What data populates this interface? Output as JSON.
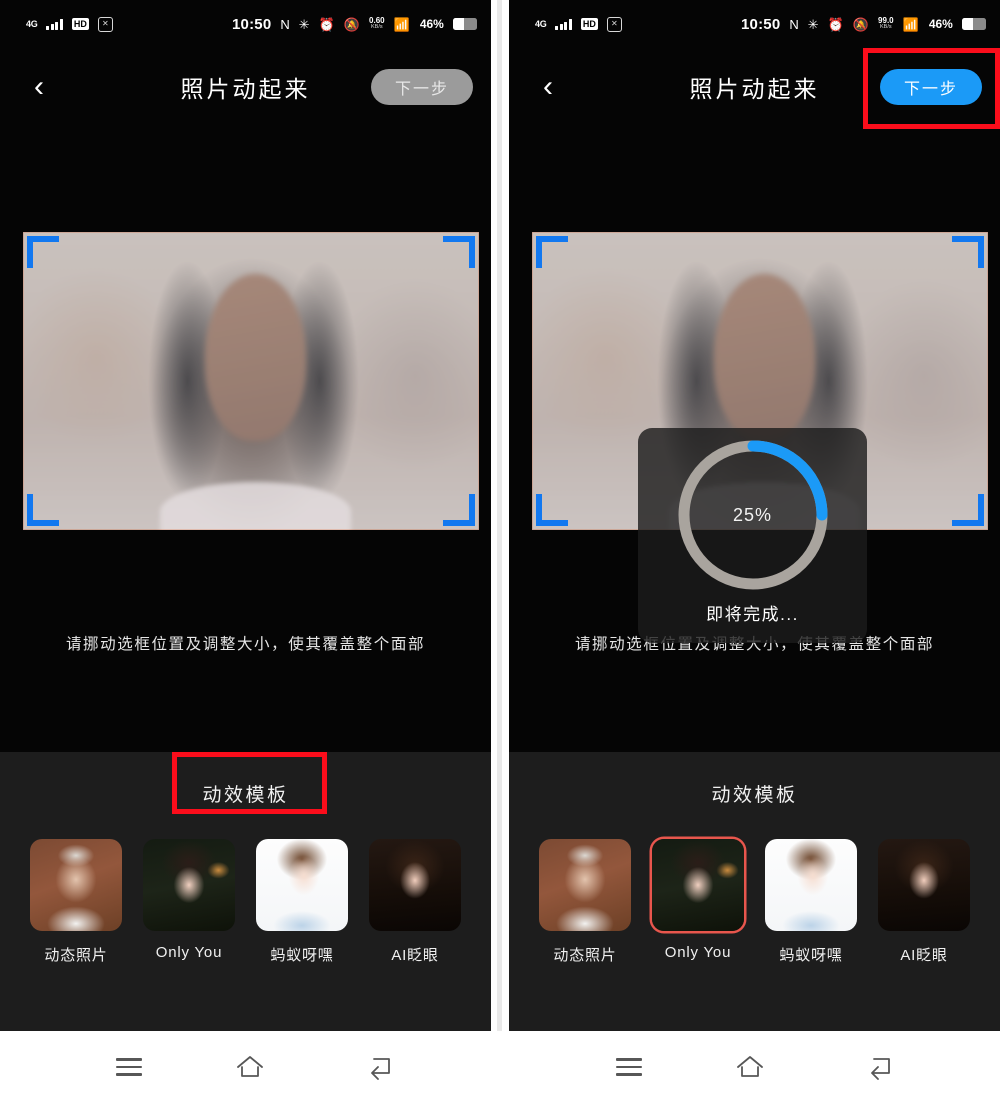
{
  "app": {
    "title": "照片动起来",
    "back_icon": "chevron-left-icon",
    "next_button": "下一步"
  },
  "status_bar": {
    "network": "4G",
    "hd_badge": "HD",
    "boxed_icon": "no-sim-icon",
    "time": "10:50",
    "nfc_icon": "nfc-icon",
    "bluetooth_icon": "bluetooth-icon",
    "alarm_icon": "alarm-icon",
    "mute_icon": "bell-muted-icon",
    "data_rate_left": {
      "value": "0.60",
      "unit": "KB/s"
    },
    "data_rate_right": {
      "value": "99.0",
      "unit": "KB/s"
    },
    "wifi_icon": "wifi-icon",
    "battery_percent": "46%",
    "battery_level": 46
  },
  "editor": {
    "hint": "请挪动选框位置及调整大小，使其覆盖整个面部",
    "crop_corner_color": "#1278f0",
    "photo_alt": "portrait-photo"
  },
  "loading": {
    "percent_label": "25%",
    "percent_value": 25,
    "status_text": "即将完成...",
    "arc_color": "#1b9af7",
    "track_color": "#a9a49e"
  },
  "templates": {
    "section_title": "动效模板",
    "items": [
      {
        "label": "动态照片",
        "thumb": "thumb-elderly-woman",
        "selected_left": false,
        "selected_right": false
      },
      {
        "label": "Only You",
        "thumb": "thumb-short-hair-woman",
        "selected_left": false,
        "selected_right": true
      },
      {
        "label": "蚂蚁呀嘿",
        "thumb": "thumb-blue-shirt-woman",
        "selected_left": false,
        "selected_right": false
      },
      {
        "label": "AI眨眼",
        "thumb": "thumb-brown-hair-woman",
        "selected_left": false,
        "selected_right": false
      }
    ],
    "selected_border_color": "#e8564d"
  },
  "nav_bar": {
    "menu_icon": "menu-icon",
    "home_icon": "home-icon",
    "back_icon": "back-arrow-icon"
  },
  "annotations": {
    "highlight_color": "#fb0d1b",
    "boxes": [
      {
        "name": "next-button-highlight",
        "target": "下一步"
      },
      {
        "name": "template-header-highlight",
        "target": "动效模板"
      }
    ]
  },
  "panels": {
    "left_state": "next-disabled",
    "right_state": "processing"
  }
}
